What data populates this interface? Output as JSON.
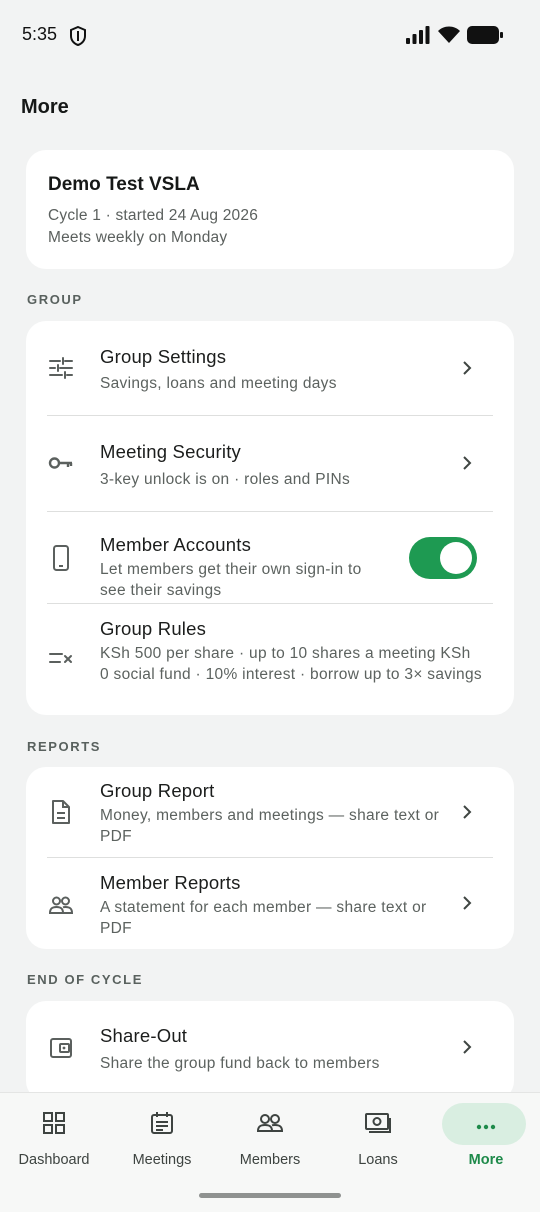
{
  "status_bar": {
    "time": "5:35"
  },
  "page": {
    "title": "More"
  },
  "group_card": {
    "name": "Demo Test VSLA",
    "cycle": "Cycle 1 · started 24 Aug 2026",
    "meets": "Meets weekly on Monday"
  },
  "sections": {
    "group": "GROUP",
    "reports": "REPORTS",
    "end_of_cycle": "END OF CYCLE"
  },
  "group_items": [
    {
      "title": "Group Settings",
      "subtitle": "Savings, loans and meeting days",
      "icon": "sliders-icon"
    },
    {
      "title": "Meeting Security",
      "subtitle": "3-key unlock is on · roles and PINs",
      "icon": "key-icon"
    },
    {
      "title": "Member Accounts",
      "subtitle": "Let members get their own sign-in to see their savings",
      "icon": "phone-icon",
      "toggle_on": true
    },
    {
      "title": "Group Rules",
      "subtitle": "KSh 500 per share · up to 10 shares a meeting KSh 0 social fund · 10% interest · borrow up to 3× savings",
      "icon": "rules-icon"
    }
  ],
  "report_items": [
    {
      "title": "Group Report",
      "subtitle": "Money, members and meetings — share text or PDF",
      "icon": "document-icon"
    },
    {
      "title": "Member Reports",
      "subtitle": "A statement for each member — share text or PDF",
      "icon": "people-icon"
    }
  ],
  "end_items": [
    {
      "title": "Share-Out",
      "subtitle": "Share the group fund back to members",
      "icon": "wallet-icon"
    }
  ],
  "nav": [
    {
      "label": "Dashboard",
      "icon": "grid-icon"
    },
    {
      "label": "Meetings",
      "icon": "calendar-icon"
    },
    {
      "label": "Members",
      "icon": "people-icon"
    },
    {
      "label": "Loans",
      "icon": "cash-icon"
    },
    {
      "label": "More",
      "icon": "more-icon",
      "active": true
    }
  ],
  "colors": {
    "accent": "#1e9a52",
    "background": "#f2f3f3",
    "card": "#ffffff",
    "active_nav_pill": "#d9eee1"
  }
}
